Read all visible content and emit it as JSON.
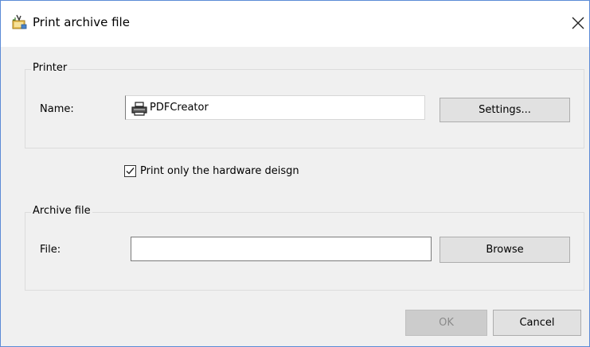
{
  "window": {
    "title": "Print archive file",
    "title_icon": "print-archive-icon",
    "close_icon": "close-icon"
  },
  "printer_group": {
    "legend": "Printer",
    "name_label": "Name:",
    "printer_name": "PDFCreator",
    "printer_icon": "printer-icon",
    "settings_button": "Settings..."
  },
  "hardware_option": {
    "label": "Print only the hardware deisgn",
    "checked": true
  },
  "archive_group": {
    "legend": "Archive file",
    "file_label": "File:",
    "file_value": "",
    "browse_button": "Browse"
  },
  "footer": {
    "ok_button": "OK",
    "ok_enabled": false,
    "cancel_button": "Cancel"
  },
  "colors": {
    "window_border": "#5b8bd6",
    "dialog_background": "#f0f0f0",
    "button_background": "#e1e1e1",
    "disabled_text": "#8a8a8a"
  }
}
